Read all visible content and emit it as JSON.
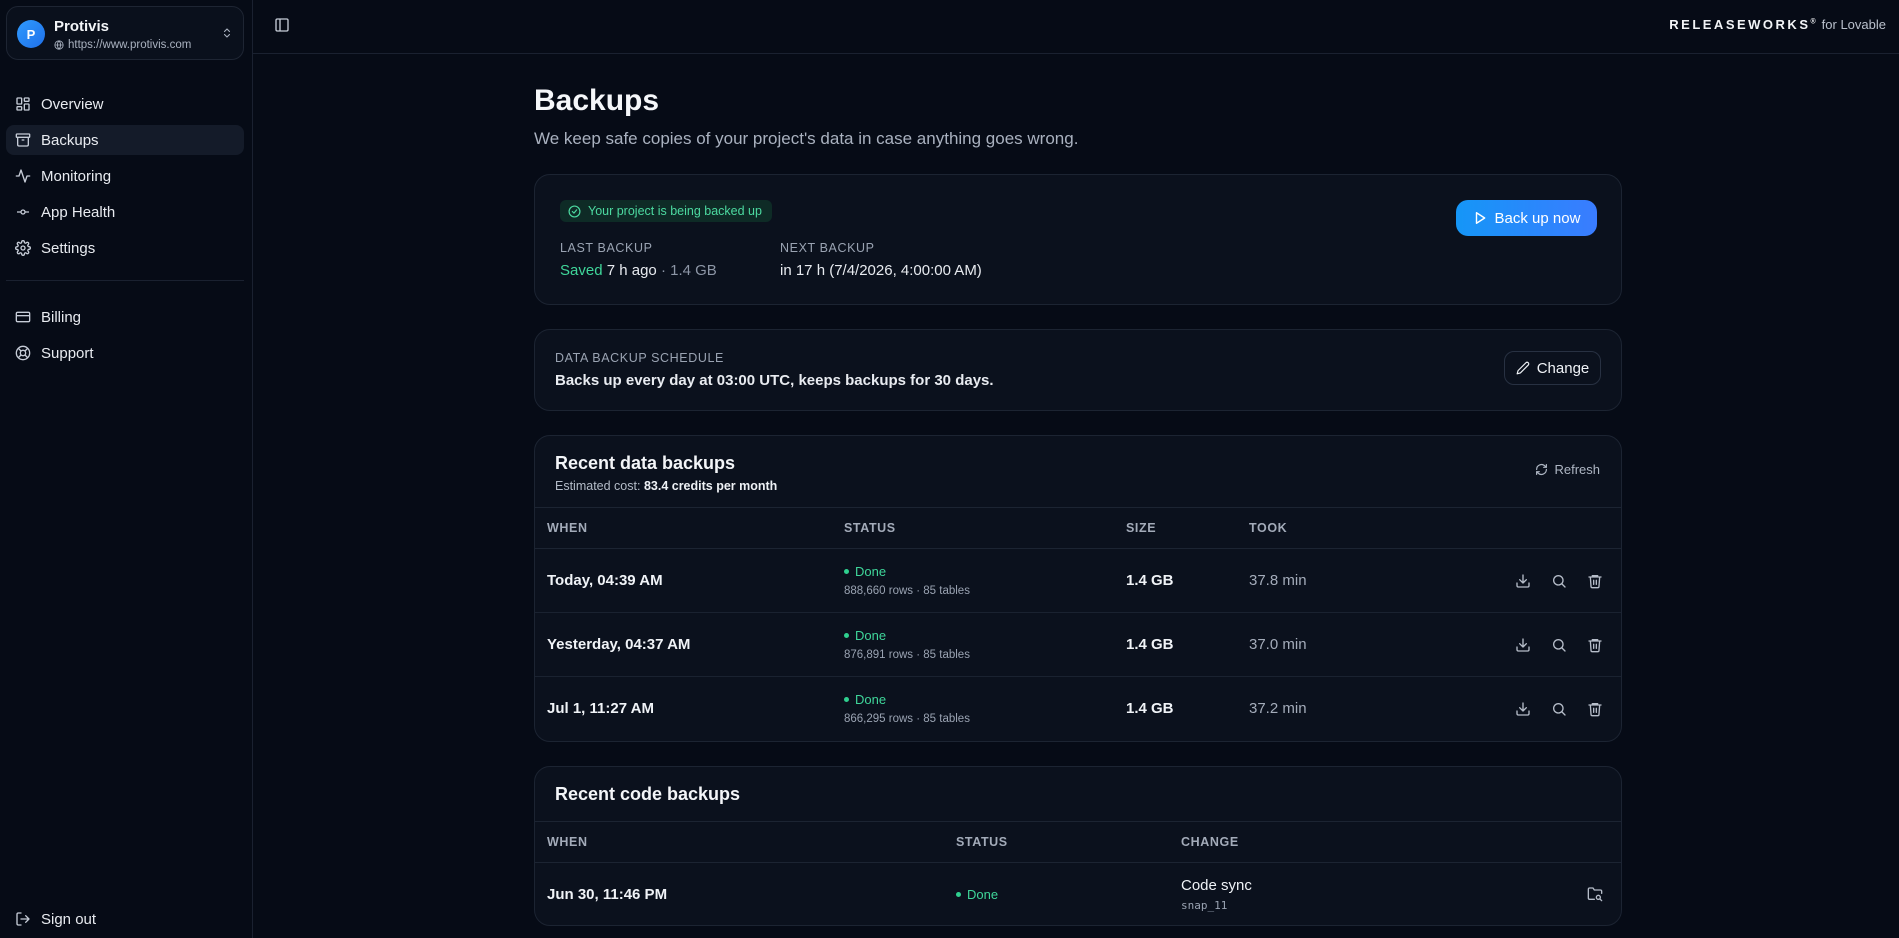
{
  "project": {
    "avatar_letter": "P",
    "name": "Protivis",
    "url": "https://www.protivis.com"
  },
  "sidebar": {
    "items": [
      {
        "label": "Overview",
        "icon": "grid-icon"
      },
      {
        "label": "Backups",
        "icon": "archive-icon",
        "active": true
      },
      {
        "label": "Monitoring",
        "icon": "activity-icon"
      },
      {
        "label": "App Health",
        "icon": "commit-icon"
      },
      {
        "label": "Settings",
        "icon": "gear-icon"
      }
    ],
    "secondary": [
      {
        "label": "Billing",
        "icon": "credit-card-icon"
      },
      {
        "label": "Support",
        "icon": "lifebuoy-icon"
      }
    ],
    "sign_out": "Sign out"
  },
  "topbar": {
    "brand": "RELEASEWORKS",
    "brand_mark": "®",
    "brand_suffix": "for Lovable"
  },
  "page": {
    "title": "Backups",
    "subtitle": "We keep safe copies of your project's data in case anything goes wrong."
  },
  "status_card": {
    "badge": "Your project is being backed up",
    "last_backup_label": "LAST BACKUP",
    "last_saved": "Saved",
    "last_ago": "7 h ago",
    "last_size": "· 1.4 GB",
    "next_backup_label": "NEXT BACKUP",
    "next_value": "in 17 h (7/4/2026, 4:00:00 AM)",
    "button": "Back up now"
  },
  "schedule_card": {
    "label": "DATA BACKUP SCHEDULE",
    "value": "Backs up every day at 03:00 UTC, keeps backups for 30 days.",
    "button": "Change"
  },
  "data_backups": {
    "title": "Recent data backups",
    "cost_prefix": "Estimated cost:",
    "cost_value": "83.4 credits per month",
    "refresh": "Refresh",
    "columns": [
      "WHEN",
      "STATUS",
      "SIZE",
      "TOOK"
    ],
    "rows": [
      {
        "when": "Today, 04:39 AM",
        "status": "Done",
        "detail": "888,660 rows · 85 tables",
        "size": "1.4 GB",
        "took": "37.8 min"
      },
      {
        "when": "Yesterday, 04:37 AM",
        "status": "Done",
        "detail": "876,891 rows · 85 tables",
        "size": "1.4 GB",
        "took": "37.0 min"
      },
      {
        "when": "Jul 1, 11:27 AM",
        "status": "Done",
        "detail": "866,295 rows · 85 tables",
        "size": "1.4 GB",
        "took": "37.2 min"
      }
    ]
  },
  "code_backups": {
    "title": "Recent code backups",
    "columns": [
      "WHEN",
      "STATUS",
      "CHANGE"
    ],
    "rows": [
      {
        "when": "Jun 30, 11:46 PM",
        "status": "Done",
        "change": "Code sync",
        "ref": "snap_11"
      }
    ]
  },
  "colors": {
    "background": "#060b16",
    "card": "#0b111d",
    "accent": "#1596f7",
    "success": "#3fd69a"
  }
}
